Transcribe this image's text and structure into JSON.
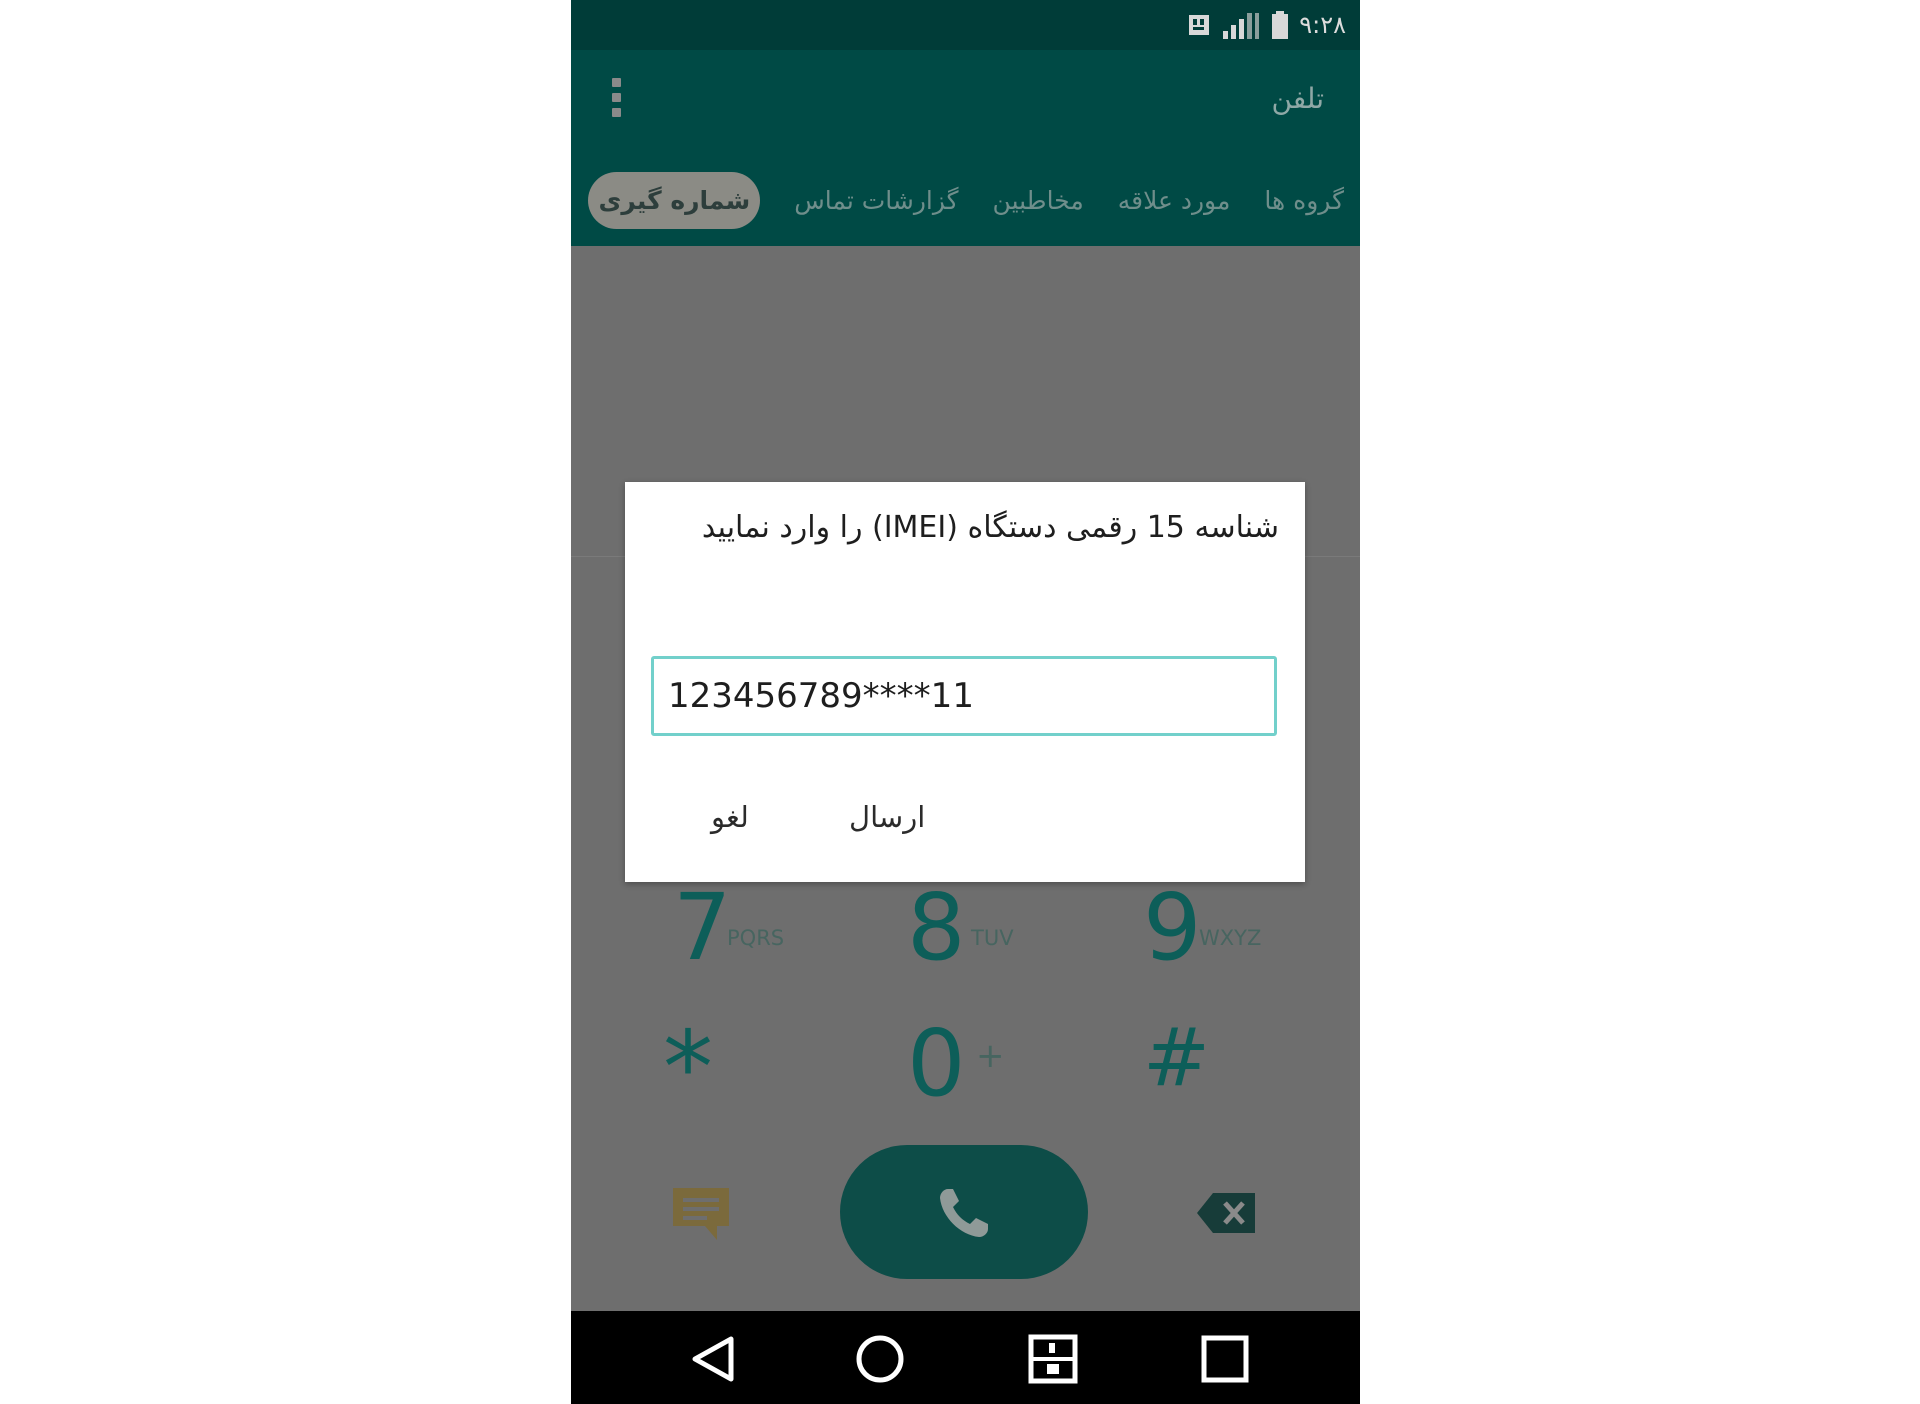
{
  "status_bar": {
    "time": "۹:۲۸",
    "icons": [
      "sim-icon",
      "signal-icon",
      "battery-icon"
    ]
  },
  "app_bar": {
    "title": "تلفن",
    "menu_icon": "more-vert-icon"
  },
  "tabs": [
    {
      "label": "گروه ها",
      "active": false
    },
    {
      "label": "مورد علاقه",
      "active": false
    },
    {
      "label": "مخاطبین",
      "active": false
    },
    {
      "label": "گزارشات تماس",
      "active": false
    },
    {
      "label": "شماره گیری",
      "active": true
    }
  ],
  "dialpad": {
    "keys": [
      {
        "digit": "7",
        "letters": "PQRS"
      },
      {
        "digit": "8",
        "letters": "TUV"
      },
      {
        "digit": "9",
        "letters": "WXYZ"
      },
      {
        "digit": "*",
        "letters": ""
      },
      {
        "digit": "0",
        "letters": "+"
      },
      {
        "digit": "#",
        "letters": ""
      }
    ],
    "actions": [
      "message-icon",
      "phone-icon",
      "backspace-icon"
    ]
  },
  "dialog": {
    "title": "شناسه 15 رقمی دستگاه (IMEI) را وارد نمایید",
    "input_value": "123456789****11",
    "buttons": {
      "send": "ارسال",
      "cancel": "لغو"
    }
  },
  "nav_bar": {
    "buttons": [
      "back-icon",
      "home-icon",
      "dual-window-icon",
      "recents-icon"
    ]
  },
  "colors": {
    "status_bar": "#003c38",
    "app_bar": "#004a45",
    "accent": "#0d5e59",
    "dim_overlay": "#6e6e6e",
    "input_border": "#72d0cb"
  }
}
